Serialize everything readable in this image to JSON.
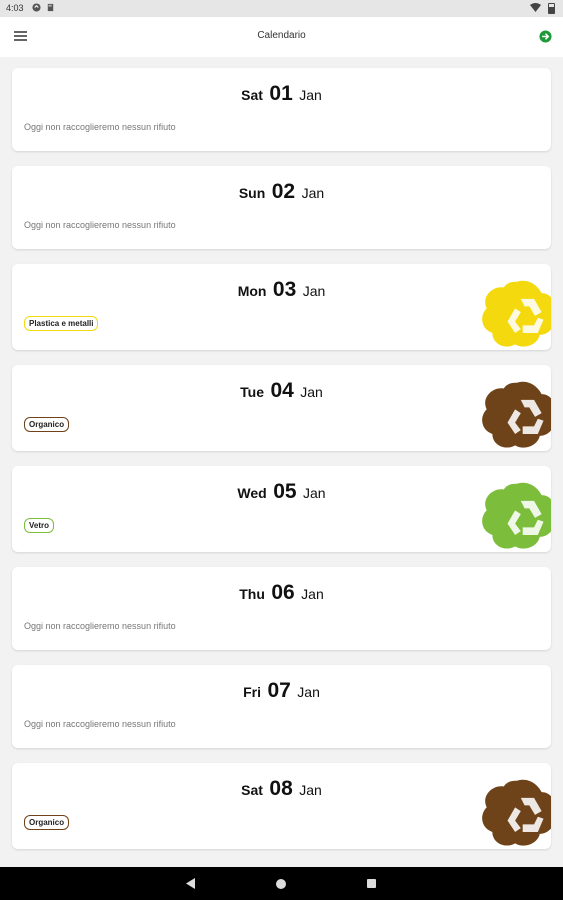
{
  "status_bar": {
    "time": "4:03"
  },
  "app_bar": {
    "title": "Calendario"
  },
  "days": [
    {
      "dow": "Sat",
      "day": "01",
      "month": "Jan",
      "message": "Oggi non raccoglieremo nessun rifiuto"
    },
    {
      "dow": "Sun",
      "day": "02",
      "month": "Jan",
      "message": "Oggi non raccoglieremo nessun rifiuto"
    },
    {
      "dow": "Mon",
      "day": "03",
      "month": "Jan",
      "chip": "Plastica e metalli",
      "color": "#f5d90f"
    },
    {
      "dow": "Tue",
      "day": "04",
      "month": "Jan",
      "chip": "Organico",
      "color": "#6e4319"
    },
    {
      "dow": "Wed",
      "day": "05",
      "month": "Jan",
      "chip": "Vetro",
      "color": "#7cbe3c"
    },
    {
      "dow": "Thu",
      "day": "06",
      "month": "Jan",
      "message": "Oggi non raccoglieremo nessun rifiuto"
    },
    {
      "dow": "Fri",
      "day": "07",
      "month": "Jan",
      "message": "Oggi non raccoglieremo nessun rifiuto"
    },
    {
      "dow": "Sat",
      "day": "08",
      "month": "Jan",
      "chip": "Organico",
      "color": "#6e4319"
    }
  ],
  "colors": {
    "exit_green": "#1e9a37",
    "app_bar_bg": "#ffffff",
    "page_bg": "#f2f2f2"
  }
}
